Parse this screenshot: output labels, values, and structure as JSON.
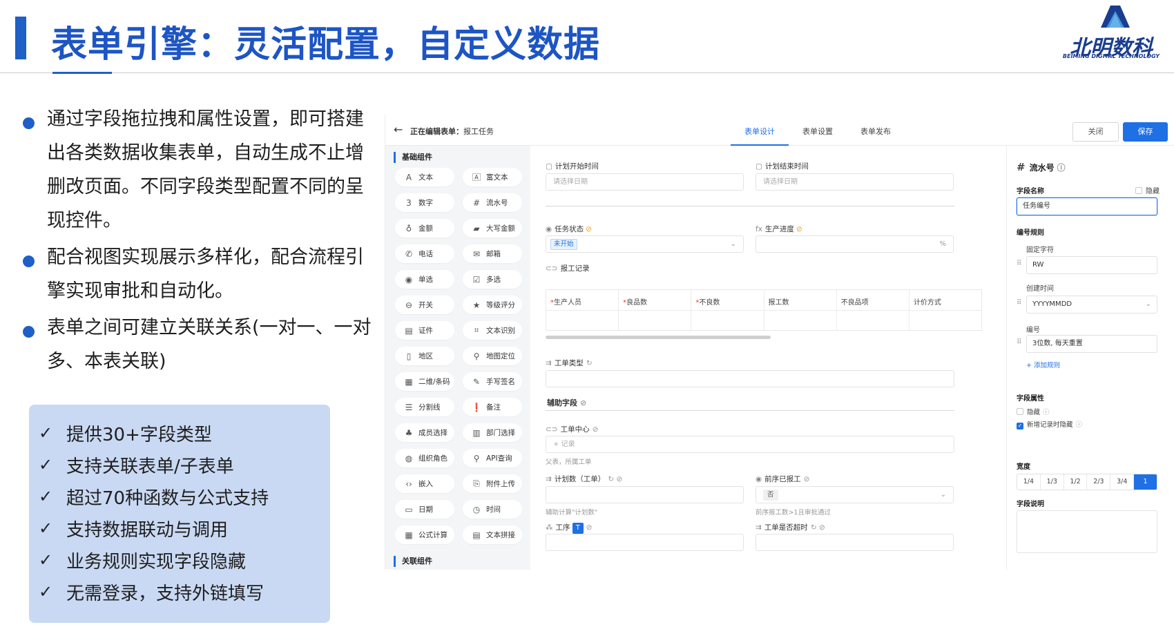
{
  "slide": {
    "title": "表单引擎：灵活配置，自定义数据",
    "logo_text": "北明数科",
    "logo_sub": "BEIMING DIGITAL TECHNOLOGY",
    "bullets": [
      "通过字段拖拉拽和属性设置，即可搭建出各类数据收集表单，自动生成不止增删改页面。不同字段类型配置不同的呈现控件。",
      "配合视图实现展示多样化，配合流程引擎实现审批和自动化。",
      "表单之间可建立关联关系(一对一、一对多、本表关联)"
    ],
    "features": [
      "提供30+字段类型",
      "支持关联表单/子表单",
      "超过70种函数与公式支持",
      "支持数据联动与调用",
      "业务规则实现字段隐藏",
      "无需登录，支持外链填写"
    ]
  },
  "app": {
    "edit_prefix": "正在编辑表单：",
    "form_name": "报工任务",
    "tabs": [
      "表单设计",
      "表单设置",
      "表单发布"
    ],
    "close_label": "关闭",
    "save_label": "保存",
    "basic_heading": "基础组件",
    "related_heading": "关联组件",
    "components": [
      {
        "icon": "A",
        "label": "文本"
      },
      {
        "icon": "🄰",
        "label": "富文本"
      },
      {
        "icon": "3",
        "label": "数字"
      },
      {
        "icon": "#",
        "label": "流水号"
      },
      {
        "icon": "♁",
        "label": "金额"
      },
      {
        "icon": "▰",
        "label": "大写金额"
      },
      {
        "icon": "✆",
        "label": "电话"
      },
      {
        "icon": "✉",
        "label": "邮箱"
      },
      {
        "icon": "◉",
        "label": "单选"
      },
      {
        "icon": "☑",
        "label": "多选"
      },
      {
        "icon": "⊖",
        "label": "开关"
      },
      {
        "icon": "★",
        "label": "等级评分"
      },
      {
        "icon": "▤",
        "label": "证件"
      },
      {
        "icon": "⌗",
        "label": "文本识别"
      },
      {
        "icon": "▯",
        "label": "地区"
      },
      {
        "icon": "⚲",
        "label": "地图定位"
      },
      {
        "icon": "▦",
        "label": "二维/条码"
      },
      {
        "icon": "✎",
        "label": "手写签名"
      },
      {
        "icon": "☰",
        "label": "分割线"
      },
      {
        "icon": "❗",
        "label": "备注"
      },
      {
        "icon": "♣",
        "label": "成员选择"
      },
      {
        "icon": "▥",
        "label": "部门选择"
      },
      {
        "icon": "◍",
        "label": "组织角色"
      },
      {
        "icon": "⚲",
        "label": "API查询"
      },
      {
        "icon": "‹›",
        "label": "嵌入"
      },
      {
        "icon": "⎘",
        "label": "附件上传"
      },
      {
        "icon": "▭",
        "label": "日期"
      },
      {
        "icon": "◷",
        "label": "时间"
      },
      {
        "icon": "▦",
        "label": "公式计算"
      },
      {
        "icon": "▤",
        "label": "文本拼接"
      }
    ],
    "canvas": {
      "plan_start_label": "计划开始时间",
      "plan_start_ph": "请选择日期",
      "plan_end_label": "计划结束时间",
      "plan_end_ph": "请选择日期",
      "task_status_label": "任务状态",
      "task_status_value": "未开始",
      "progress_label": "生产进度",
      "progress_unit": "%",
      "report_label": "报工记录",
      "table_headers": [
        "生产人员",
        "良品数",
        "不良数",
        "报工数",
        "不良品项",
        "计价方式"
      ],
      "order_type_label": "工单类型",
      "aux_section": "辅助字段",
      "center_label": "工单中心",
      "center_ph": "+ 记录",
      "center_hint": "父表，所属工单",
      "plan_count_label": "计划数（工单）",
      "plan_count_hint": "辅助计算\"计划数\"",
      "prev_report_label": "前序已报工",
      "prev_report_value": "否",
      "prev_report_hint": "前序报工数>1且审批通过",
      "process_label": "工序",
      "process_badge": "T",
      "overtime_label": "工单是否超时"
    },
    "props": {
      "field_type": "流水号",
      "field_name_label": "字段名称",
      "hide_label": "隐藏",
      "field_name_value": "任务编号",
      "rule_label": "编号规则",
      "fixed_char_label": "固定字符",
      "fixed_char_value": "RW",
      "created_label": "创建时间",
      "created_value": "YYYYMMDD",
      "number_label": "编号",
      "number_value": "3位数, 每天重置",
      "add_rule": "+ 添加规则",
      "attr_label": "字段属性",
      "attr_hide": "隐藏",
      "attr_hide_new": "新增记录时隐藏",
      "width_label": "宽度",
      "widths": [
        "1/4",
        "1/3",
        "1/2",
        "2/3",
        "3/4",
        "1"
      ],
      "desc_label": "字段说明"
    }
  },
  "colors": {
    "brand_blue": "#1f5fc8",
    "accent": "#1f6fe5",
    "feature_bg": "#c9d9f3"
  }
}
